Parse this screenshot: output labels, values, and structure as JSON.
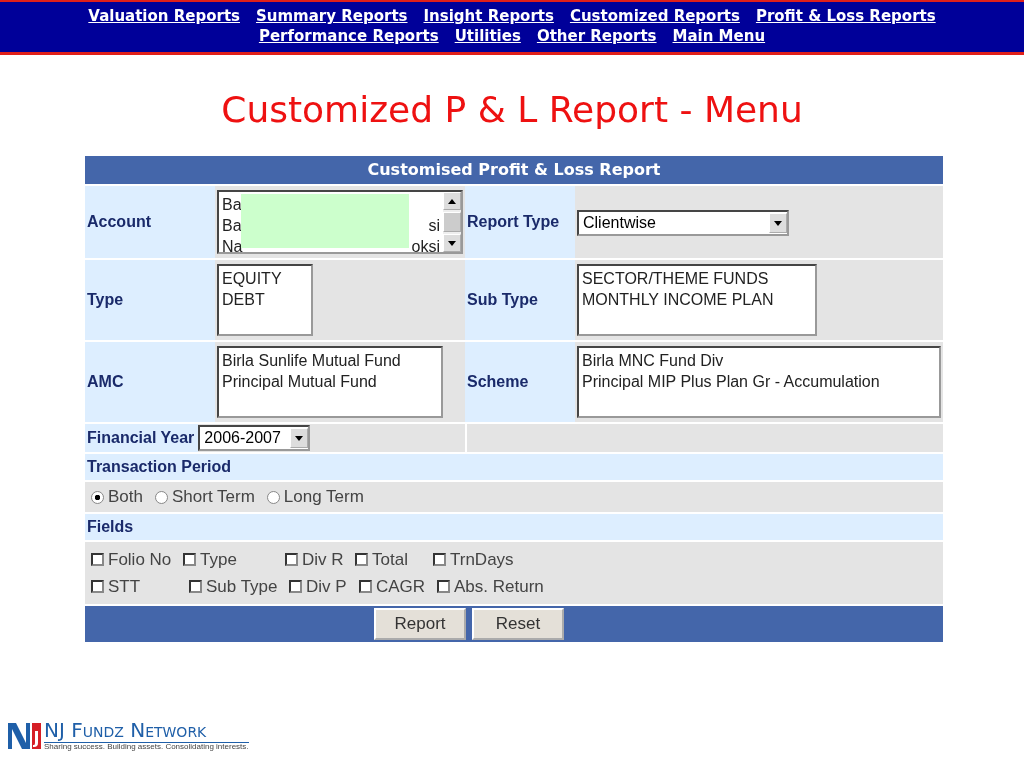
{
  "nav": {
    "links": [
      "Valuation Reports",
      "Summary Reports",
      "Insight Reports",
      "Customized Reports",
      "Profit & Loss Reports",
      "Performance Reports",
      "Utilities",
      "Other Reports",
      "Main Menu"
    ]
  },
  "page_title": "Customized P & L Report - Menu",
  "form": {
    "title": "Customised Profit & Loss Report",
    "account": {
      "label": "Account",
      "options": [
        {
          "start": "Ba"
        },
        {
          "start": "Ba",
          "end": "si"
        },
        {
          "start": "Na",
          "end": "oksi"
        }
      ]
    },
    "report_type": {
      "label": "Report Type",
      "value": "Clientwise"
    },
    "type": {
      "label": "Type",
      "options": [
        "EQUITY",
        "DEBT"
      ]
    },
    "sub_type": {
      "label": "Sub Type",
      "options": [
        "SECTOR/THEME FUNDS",
        "MONTHLY INCOME PLAN"
      ]
    },
    "amc": {
      "label": "AMC",
      "options": [
        "Birla Sunlife Mutual Fund",
        "Principal Mutual Fund"
      ]
    },
    "scheme": {
      "label": "Scheme",
      "options": [
        "Birla MNC Fund Div",
        "Principal MIP Plus Plan Gr - Accumulation"
      ]
    },
    "financial_year": {
      "label": "Financial Year",
      "value": "2006-2007"
    },
    "transaction_period": {
      "label": "Transaction Period",
      "options": [
        {
          "label": "Both",
          "selected": true
        },
        {
          "label": "Short Term",
          "selected": false
        },
        {
          "label": "Long Term",
          "selected": false
        }
      ]
    },
    "fields": {
      "label": "Fields",
      "rows": [
        [
          {
            "label": "Folio No",
            "checked": false
          },
          {
            "label": "Type",
            "checked": false
          },
          {
            "label": "Div R",
            "checked": false
          },
          {
            "label": "Total",
            "checked": false
          },
          {
            "label": "TrnDays",
            "checked": false
          }
        ],
        [
          {
            "label": "STT",
            "checked": false
          },
          {
            "label": "Sub Type",
            "checked": false
          },
          {
            "label": "Div P",
            "checked": false
          },
          {
            "label": "CAGR",
            "checked": false
          },
          {
            "label": "Abs. Return",
            "checked": false
          }
        ]
      ]
    },
    "buttons": [
      "Report",
      "Reset"
    ]
  },
  "logo": {
    "name": "NJ Fundz Network",
    "tagline": "Sharing success. Building assets. Consolidating interests."
  }
}
